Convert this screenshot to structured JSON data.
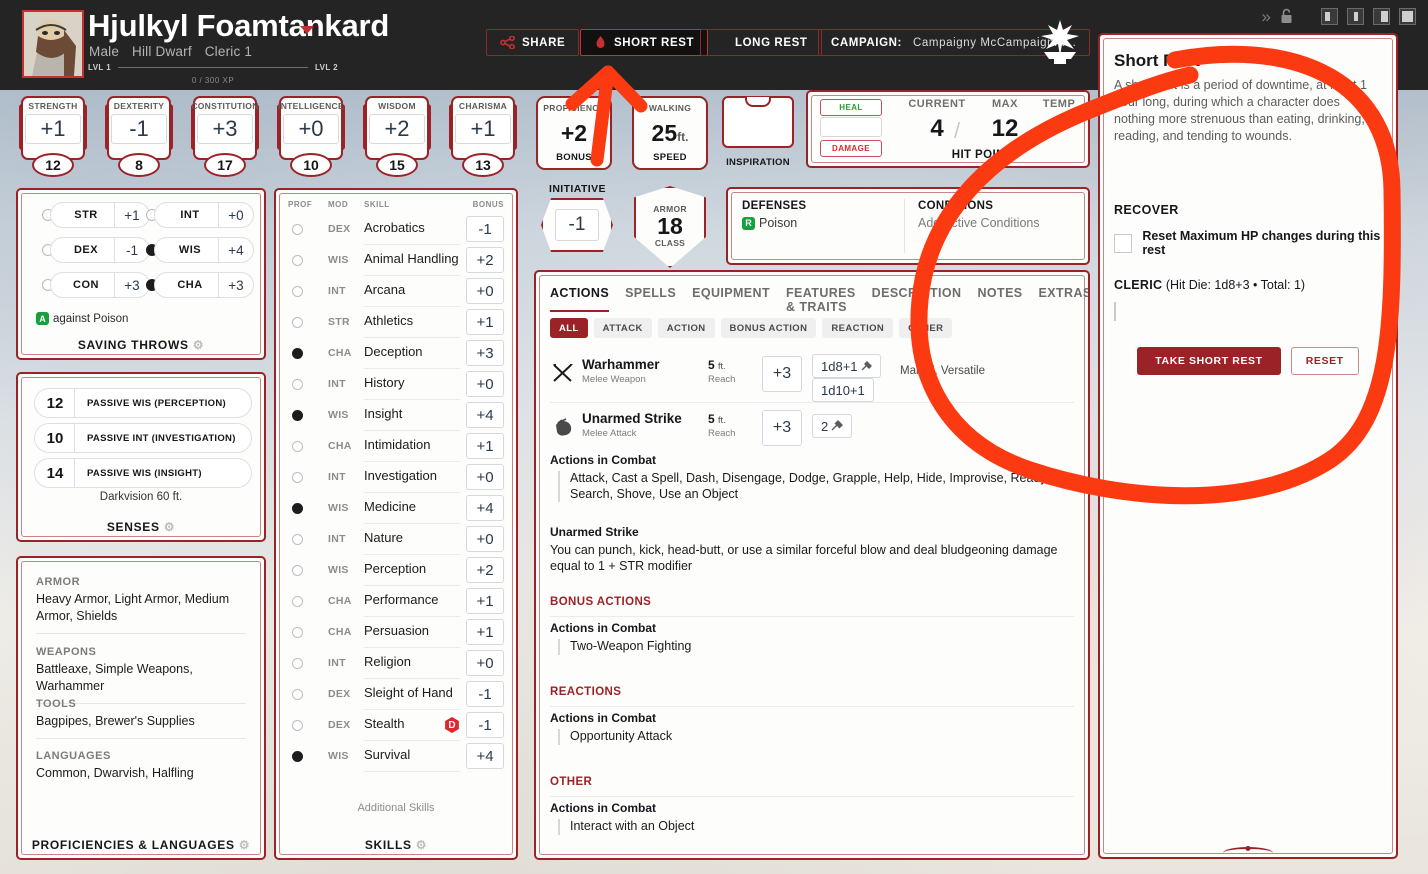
{
  "character": {
    "name": "Hjulkyl Foamtankard",
    "gender": "Male",
    "race": "Hill Dwarf",
    "class_level": "Cleric 1",
    "level_from": "LVL 1",
    "level_to": "LVL 2",
    "xp": "0 / 300 XP"
  },
  "topbar": {
    "share_label": "SHARE",
    "short_rest_label": "SHORT REST",
    "long_rest_label": "LONG REST",
    "campaign_label": "CAMPAIGN:",
    "campaign_value": "Campaigny McCampaignfa…"
  },
  "abilities": [
    {
      "name": "STRENGTH",
      "mod": "+1",
      "score": "12"
    },
    {
      "name": "DEXTERITY",
      "mod": "-1",
      "score": "8"
    },
    {
      "name": "CONSTITUTION",
      "mod": "+3",
      "score": "17"
    },
    {
      "name": "INTELLIGENCE",
      "mod": "+0",
      "score": "10"
    },
    {
      "name": "WISDOM",
      "mod": "+2",
      "score": "15"
    },
    {
      "name": "CHARISMA",
      "mod": "+1",
      "score": "13"
    }
  ],
  "proficiency": {
    "top": "PROFICIENCY",
    "value": "+2",
    "bottom": "BONUS"
  },
  "speed": {
    "top": "WALKING",
    "value": "25",
    "unit": "ft.",
    "bottom": "SPEED"
  },
  "inspiration": {
    "label": "INSPIRATION"
  },
  "hit_points": {
    "heal_label": "HEAL",
    "damage_label": "DAMAGE",
    "current_label": "CURRENT",
    "max_label": "MAX",
    "temp_label": "TEMP",
    "current": "4",
    "max": "12",
    "temp": "--",
    "footer": "HIT POINTS"
  },
  "initiative": {
    "label": "INITIATIVE",
    "value": "-1"
  },
  "armor_class": {
    "top": "ARMOR",
    "value": "18",
    "bottom": "CLASS"
  },
  "defenses": {
    "defenses_label": "DEFENSES",
    "defenses_value": "Poison",
    "defenses_badge": "R",
    "conditions_label": "CONDITIONS",
    "conditions_value": "Add Active Conditions"
  },
  "saving_throws": {
    "items": [
      {
        "name": "STR",
        "bonus": "+1",
        "proficient": false
      },
      {
        "name": "INT",
        "bonus": "+0",
        "proficient": false
      },
      {
        "name": "DEX",
        "bonus": "-1",
        "proficient": false
      },
      {
        "name": "WIS",
        "bonus": "+4",
        "proficient": true
      },
      {
        "name": "CON",
        "bonus": "+3",
        "proficient": false
      },
      {
        "name": "CHA",
        "bonus": "+3",
        "proficient": true
      }
    ],
    "note_badge": "A",
    "note": "against Poison",
    "footer": "SAVING THROWS"
  },
  "senses": {
    "rows": [
      {
        "value": "12",
        "label": "PASSIVE WIS (PERCEPTION)"
      },
      {
        "value": "10",
        "label": "PASSIVE INT (INVESTIGATION)"
      },
      {
        "value": "14",
        "label": "PASSIVE WIS (INSIGHT)"
      }
    ],
    "extra": "Darkvision 60 ft.",
    "footer": "SENSES"
  },
  "proficiencies": {
    "sections": [
      {
        "title": "ARMOR",
        "value": "Heavy Armor, Light Armor, Medium Armor, Shields"
      },
      {
        "title": "WEAPONS",
        "value": "Battleaxe, Simple Weapons, Warhammer"
      },
      {
        "title": "TOOLS",
        "value": "Bagpipes, Brewer's Supplies"
      },
      {
        "title": "LANGUAGES",
        "value": "Common, Dwarvish, Halfling"
      }
    ],
    "footer": "PROFICIENCIES & LANGUAGES"
  },
  "skills": {
    "headers": {
      "prof": "PROF",
      "mod": "MOD",
      "skill": "SKILL",
      "bonus": "BONUS"
    },
    "rows": [
      {
        "prof": false,
        "mod": "DEX",
        "name": "Acrobatics",
        "bonus": "-1"
      },
      {
        "prof": false,
        "mod": "WIS",
        "name": "Animal Handling",
        "bonus": "+2"
      },
      {
        "prof": false,
        "mod": "INT",
        "name": "Arcana",
        "bonus": "+0"
      },
      {
        "prof": false,
        "mod": "STR",
        "name": "Athletics",
        "bonus": "+1"
      },
      {
        "prof": true,
        "mod": "CHA",
        "name": "Deception",
        "bonus": "+3"
      },
      {
        "prof": false,
        "mod": "INT",
        "name": "History",
        "bonus": "+0"
      },
      {
        "prof": true,
        "mod": "WIS",
        "name": "Insight",
        "bonus": "+4"
      },
      {
        "prof": false,
        "mod": "CHA",
        "name": "Intimidation",
        "bonus": "+1"
      },
      {
        "prof": false,
        "mod": "INT",
        "name": "Investigation",
        "bonus": "+0"
      },
      {
        "prof": true,
        "mod": "WIS",
        "name": "Medicine",
        "bonus": "+4"
      },
      {
        "prof": false,
        "mod": "INT",
        "name": "Nature",
        "bonus": "+0"
      },
      {
        "prof": false,
        "mod": "WIS",
        "name": "Perception",
        "bonus": "+2"
      },
      {
        "prof": false,
        "mod": "CHA",
        "name": "Performance",
        "bonus": "+1"
      },
      {
        "prof": false,
        "mod": "CHA",
        "name": "Persuasion",
        "bonus": "+1"
      },
      {
        "prof": false,
        "mod": "INT",
        "name": "Religion",
        "bonus": "+0"
      },
      {
        "prof": false,
        "mod": "DEX",
        "name": "Sleight of Hand",
        "bonus": "-1"
      },
      {
        "prof": false,
        "mod": "DEX",
        "name": "Stealth",
        "bonus": "-1",
        "disadvantage": "D"
      },
      {
        "prof": true,
        "mod": "WIS",
        "name": "Survival",
        "bonus": "+4"
      }
    ],
    "additional": "Additional Skills",
    "footer": "SKILLS"
  },
  "main": {
    "tabs": [
      {
        "label": "ACTIONS",
        "active": true
      },
      {
        "label": "SPELLS",
        "active": false
      },
      {
        "label": "EQUIPMENT",
        "active": false
      },
      {
        "label": "FEATURES & TRAITS",
        "active": false
      },
      {
        "label": "DESCRIPTION",
        "active": false
      },
      {
        "label": "NOTES",
        "active": false
      },
      {
        "label": "EXTRAS",
        "active": false
      }
    ],
    "filters": [
      {
        "label": "ALL",
        "active": true
      },
      {
        "label": "ATTACK",
        "active": false
      },
      {
        "label": "ACTION",
        "active": false
      },
      {
        "label": "BONUS ACTION",
        "active": false
      },
      {
        "label": "REACTION",
        "active": false
      },
      {
        "label": "OTHER",
        "active": false
      }
    ],
    "attacks": [
      {
        "name": "Warhammer",
        "type": "Melee Weapon",
        "range": "5",
        "range_unit": "ft.",
        "range_sub": "Reach",
        "hit": "+3",
        "damage": "1d8+1",
        "damage_alt": "1d10+1",
        "notes": "Martial, Versatile"
      },
      {
        "name": "Unarmed Strike",
        "type": "Melee Attack",
        "range": "5",
        "range_unit": "ft.",
        "range_sub": "Reach",
        "hit": "+3",
        "damage": "2",
        "damage_alt": "",
        "notes": ""
      }
    ],
    "actions_in_combat_label": "Actions in Combat",
    "actions_in_combat_list": "Attack, Cast a Spell, Dash, Disengage, Dodge, Grapple, Help, Hide, Improvise, Ready, Search, Shove, Use an Object",
    "unarmed_strike_heading": "Unarmed Strike",
    "unarmed_strike_text": "You can punch, kick, head-butt, or use a similar forceful blow and deal bludgeoning damage equal to 1 + STR modifier",
    "bonus_actions_heading": "BONUS ACTIONS",
    "bonus_actions_item": "Two-Weapon Fighting",
    "reactions_heading": "REACTIONS",
    "reactions_item": "Opportunity Attack",
    "other_heading": "OTHER",
    "other_item": "Interact with an Object"
  },
  "short_rest": {
    "title": "Short Rest",
    "description": "A short rest is a period of downtime, at least 1 hour long, during which a character does nothing more strenuous than eating, drinking, reading, and tending to wounds.",
    "recover_label": "RECOVER",
    "reset_hp_label": "Reset Maximum HP changes during this rest",
    "class_name": "CLERIC",
    "hit_die_info": "(Hit Die: 1d8+3 • Total: 1)",
    "take_label": "TAKE SHORT REST",
    "reset_label": "RESET"
  },
  "colors": {
    "accent_red": "#9b2226",
    "annotation_red": "#fc3a12",
    "topbar_bg": "#242424",
    "green": "#1b9e3e",
    "damage_red": "#e0252b"
  }
}
